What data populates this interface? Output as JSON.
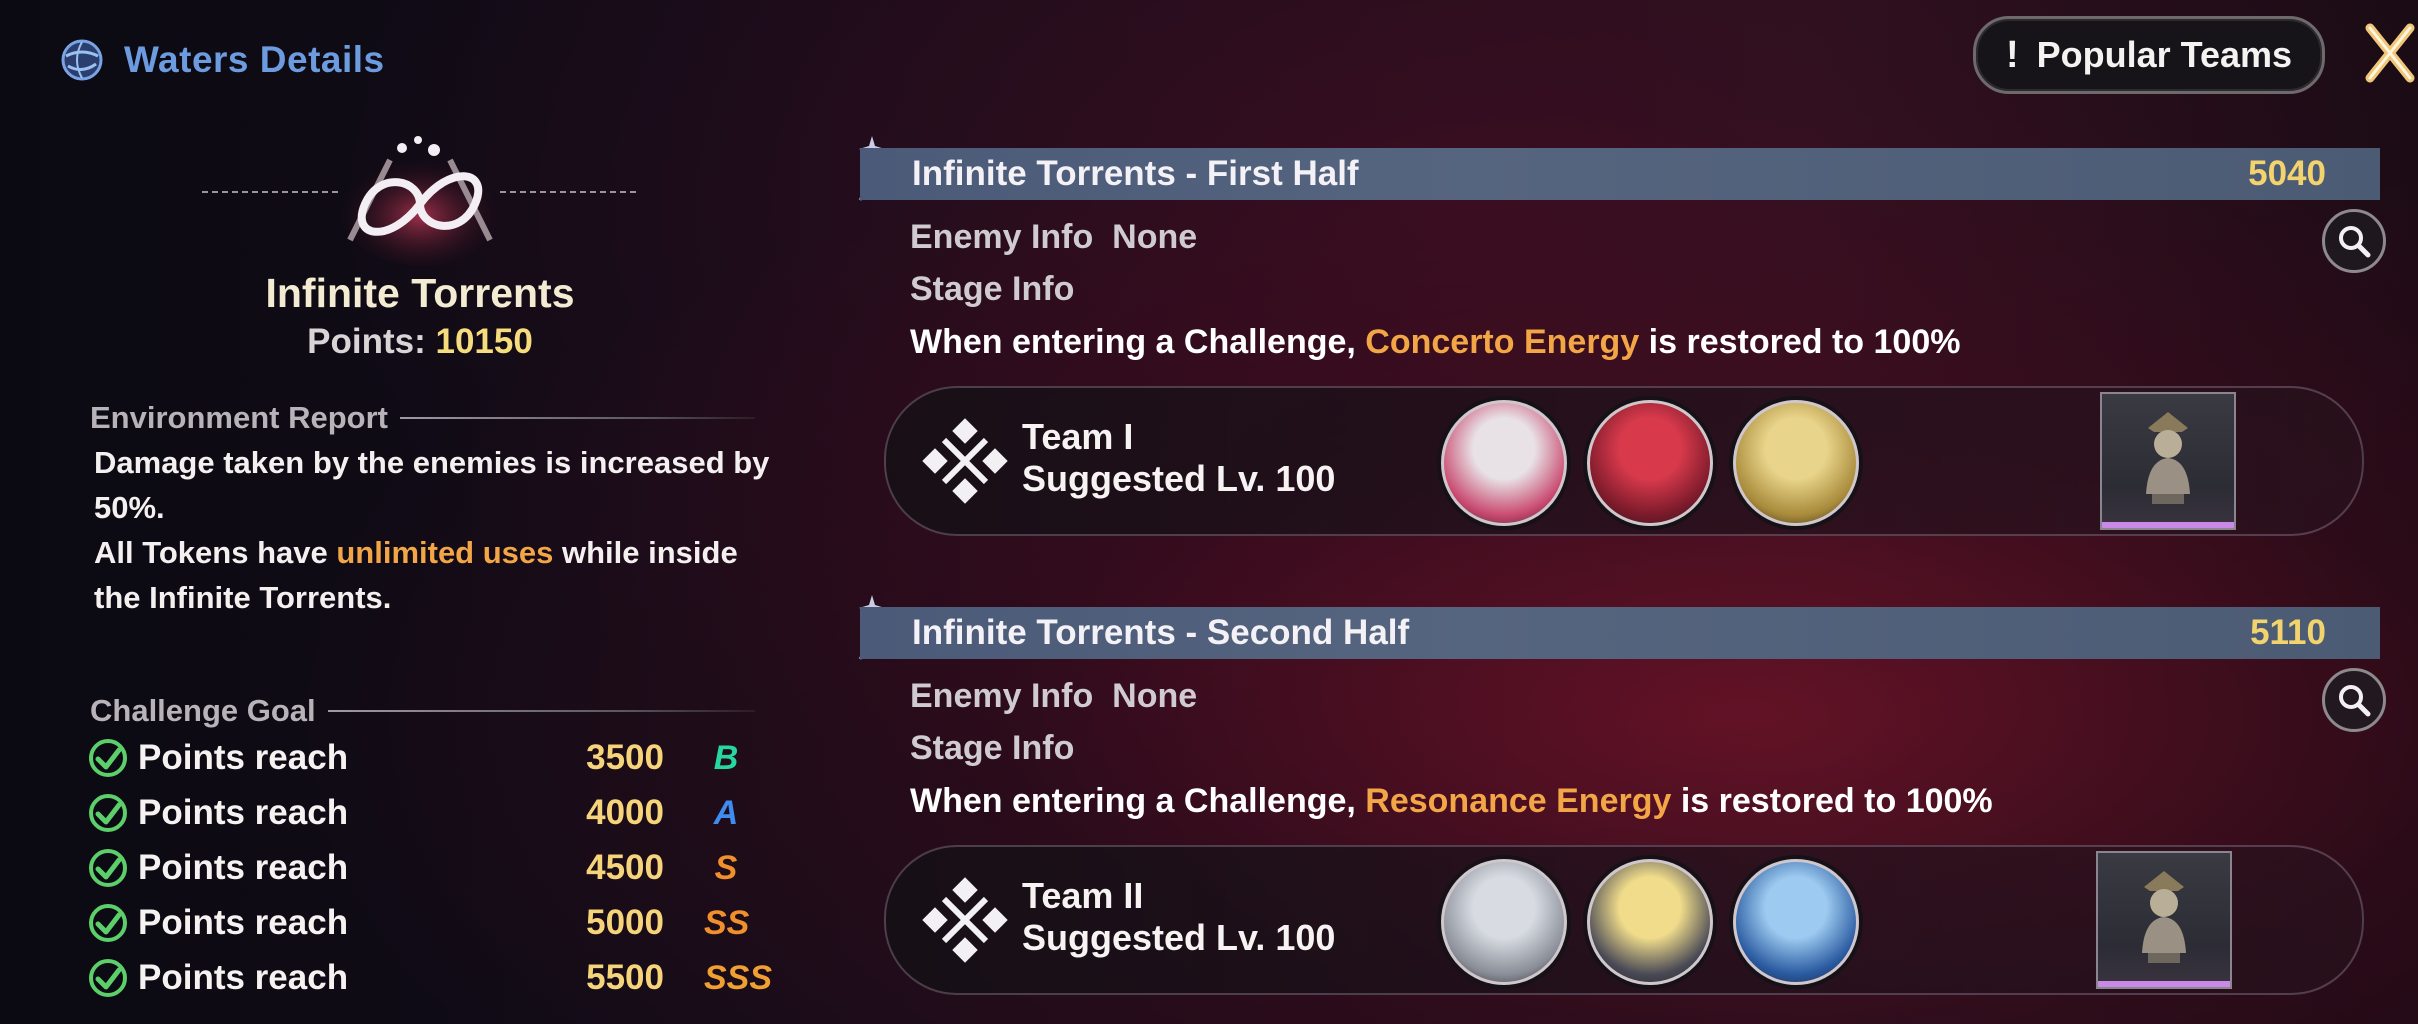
{
  "header": {
    "title": "Waters Details",
    "popular_button_mark": "!",
    "popular_button_label": "Popular Teams"
  },
  "left": {
    "stage_name": "Infinite Torrents",
    "points_label": "Points:",
    "points_value": "10150",
    "environment_heading": "Environment Report",
    "environment_p1": "Damage taken by the enemies is increased by 50%.",
    "environment_p2_a": "All Tokens have ",
    "environment_p2_hl": "unlimited uses",
    "environment_p2_b": " while inside the Infinite Torrents.",
    "goal_heading": "Challenge Goal",
    "goals": [
      {
        "label": "Points reach",
        "value": "3500",
        "rank": "B",
        "rank_color": "#27d6a0"
      },
      {
        "label": "Points reach",
        "value": "4000",
        "rank": "A",
        "rank_color": "#3f8cf0"
      },
      {
        "label": "Points reach",
        "value": "4500",
        "rank": "S",
        "rank_color": "#f0902c"
      },
      {
        "label": "Points reach",
        "value": "5000",
        "rank": "SS",
        "rank_color": "#f0902c"
      },
      {
        "label": "Points reach",
        "value": "5500",
        "rank": "SSS",
        "rank_color": "#f0a030"
      }
    ]
  },
  "halves": [
    {
      "name": "Infinite Torrents - First Half",
      "score": "5040",
      "enemy_label": "Enemy Info",
      "enemy_value": "None",
      "stage_label": "Stage Info",
      "desc_a": "When entering a Challenge, ",
      "desc_hl": "Concerto Energy",
      "desc_b": " is restored to 100%",
      "team_name": "Team I",
      "team_level": "Suggested Lv. 100"
    },
    {
      "name": "Infinite Torrents - Second Half",
      "score": "5110",
      "enemy_label": "Enemy Info",
      "enemy_value": "None",
      "stage_label": "Stage Info",
      "desc_a": "When entering a Challenge, ",
      "desc_hl": "Resonance Energy",
      "desc_b": " is restored to 100%",
      "team_name": "Team II",
      "team_level": "Suggested Lv. 100"
    }
  ],
  "icons": {
    "globe": "globe-icon",
    "close": "close-icon",
    "check": "check-icon",
    "search": "search-icon",
    "team": "team-emblem-icon",
    "echo": "echo-bust-icon"
  },
  "colors": {
    "accent_blue": "#6d9be0",
    "highlight_orange": "#f2a646",
    "score_gold": "#f3d36e",
    "check_green": "#5ccf6a"
  }
}
